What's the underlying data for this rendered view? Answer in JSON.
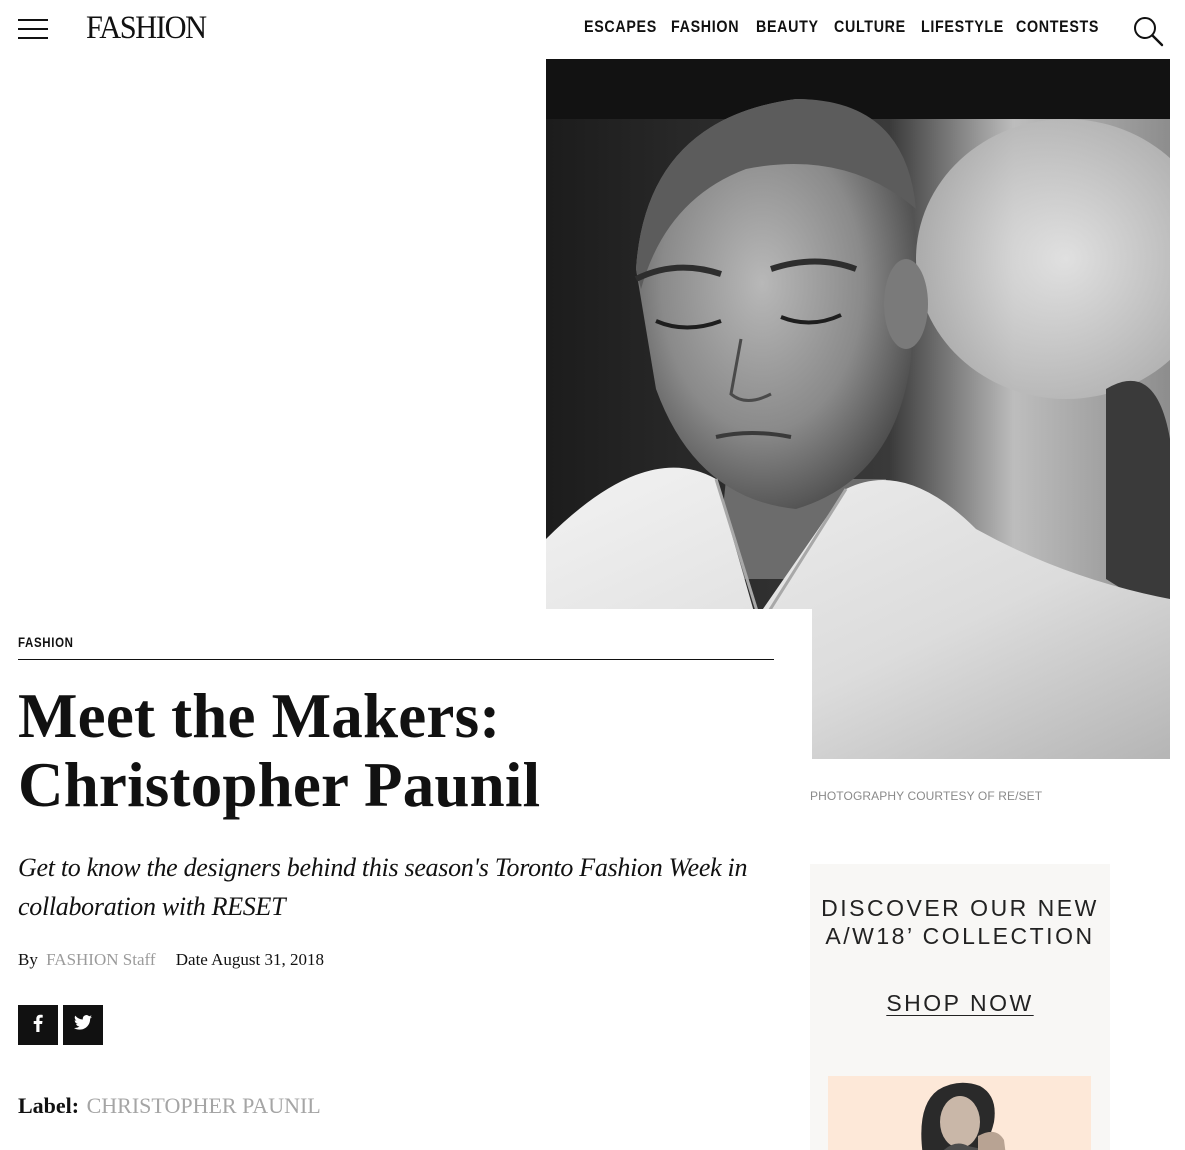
{
  "header": {
    "logo": "FASHION",
    "nav": [
      "ESCAPES",
      "FASHION",
      "BEAUTY",
      "CULTURE",
      "LIFESTYLE",
      "CONTESTS"
    ]
  },
  "hero": {
    "credit": "PHOTOGRAPHY COURTESY OF RE/SET"
  },
  "article": {
    "kicker": "FASHION",
    "title_line1": "Meet the Makers:",
    "title_line2": "Christopher Paunil",
    "dek": "Get to know the designers behind this season's Toronto Fashion Week in collaboration with RESET",
    "by_prefix": "By",
    "author": "FASHION Staff",
    "date_label": "Date",
    "date": "August 31, 2018",
    "label_prefix": "Label:",
    "label_value": "CHRISTOPHER PAUNIL"
  },
  "ad": {
    "headline_line1": "DISCOVER OUR NEW",
    "headline_line2": "A/W18’ COLLECTION",
    "cta": "SHOP NOW"
  },
  "icons": [
    "hamburger-menu-icon",
    "search-icon",
    "facebook-icon",
    "twitter-icon"
  ],
  "colors": {
    "text": "#111111",
    "muted": "#9b9b9b",
    "ad_bg": "#f8f7f5",
    "ad_image_bg": "#fde8d8"
  }
}
